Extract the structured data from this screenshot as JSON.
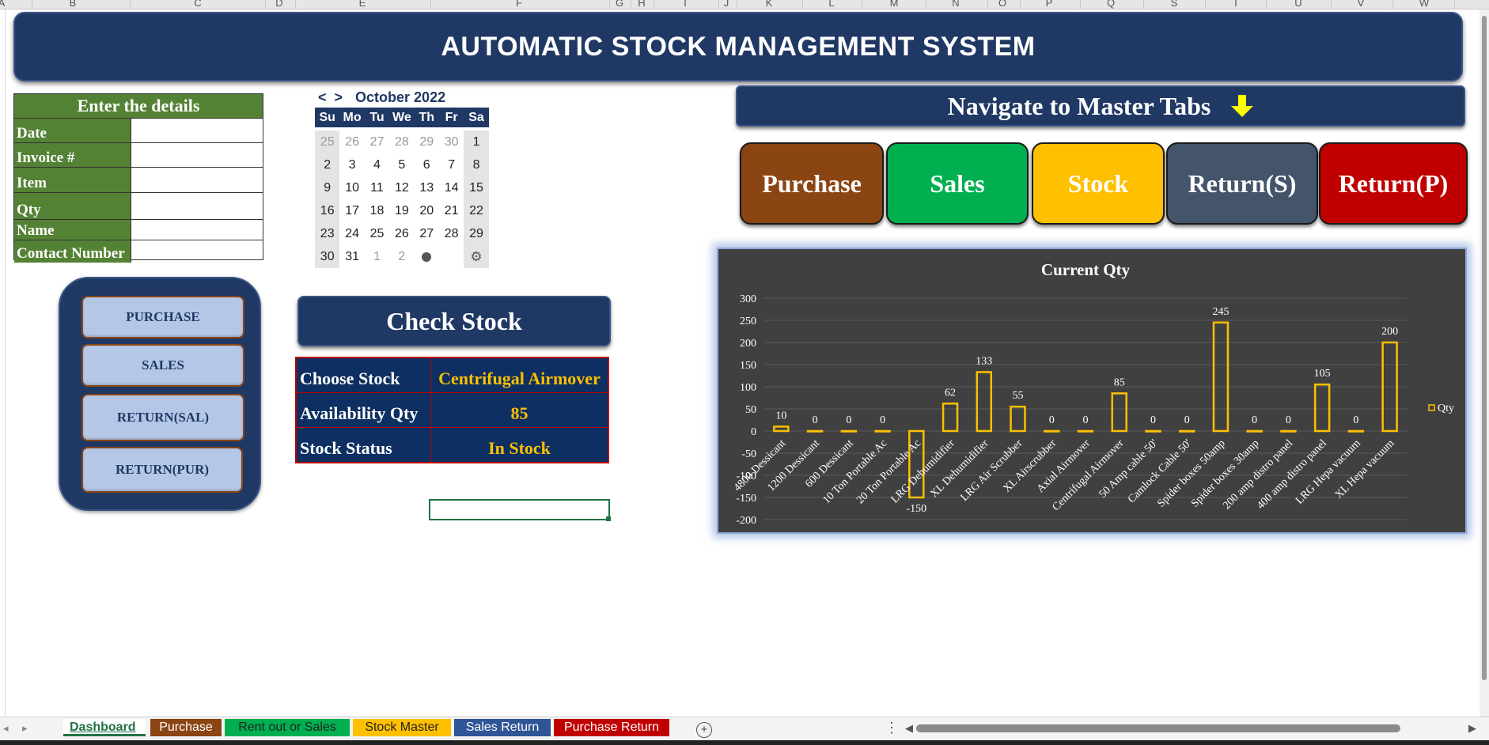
{
  "columns": [
    "A",
    "B",
    "C",
    "D",
    "E",
    "F",
    "G",
    "H",
    "I",
    "J",
    "K",
    "L",
    "M",
    "N",
    "O",
    "P",
    "Q",
    "S",
    "T",
    "U",
    "V",
    "W"
  ],
  "banner": {
    "title": "AUTOMATIC STOCK MANAGEMENT SYSTEM"
  },
  "details": {
    "header": "Enter the details",
    "fields": [
      {
        "label": "Date",
        "value": ""
      },
      {
        "label": "Invoice #",
        "value": ""
      },
      {
        "label": "Item",
        "value": ""
      },
      {
        "label": "Qty",
        "value": ""
      },
      {
        "label": "Name",
        "value": ""
      },
      {
        "label": "Contact Number",
        "value": ""
      }
    ]
  },
  "calendar": {
    "prev": "<",
    "next": ">",
    "month": "October 2022",
    "weekdays": [
      "Su",
      "Mo",
      "Tu",
      "We",
      "Th",
      "Fr",
      "Sa"
    ],
    "weeks": [
      [
        "25",
        "26",
        "27",
        "28",
        "29",
        "30",
        "1"
      ],
      [
        "2",
        "3",
        "4",
        "5",
        "6",
        "7",
        "8"
      ],
      [
        "9",
        "10",
        "11",
        "12",
        "13",
        "14",
        "15"
      ],
      [
        "16",
        "17",
        "18",
        "19",
        "20",
        "21",
        "22"
      ],
      [
        "23",
        "24",
        "25",
        "26",
        "27",
        "28",
        "29"
      ],
      [
        "30",
        "31",
        "1",
        "2",
        "",
        "",
        " "
      ]
    ]
  },
  "left_nav": {
    "buttons": [
      "PURCHASE",
      "SALES",
      "RETURN(SAL)",
      "RETURN(PUR)"
    ]
  },
  "check_stock": {
    "title": "Check Stock",
    "rows": [
      {
        "label": "Choose Stock",
        "value": "Centrifugal Airmover"
      },
      {
        "label": "Availability Qty",
        "value": "85"
      },
      {
        "label": "Stock Status",
        "value": "In Stock"
      }
    ]
  },
  "navigate": {
    "title": "Navigate to Master Tabs",
    "icon": "down-arrow-icon"
  },
  "master_buttons": [
    {
      "label": "Purchase",
      "color": "#8b4513"
    },
    {
      "label": "Sales",
      "color": "#00b050"
    },
    {
      "label": "Stock",
      "color": "#ffc000"
    },
    {
      "label": "Return(S)",
      "color": "#44546a"
    },
    {
      "label": "Return(P)",
      "color": "#c00000"
    }
  ],
  "chart_data": {
    "type": "bar",
    "title": "Current Qty",
    "categories": [
      "4800 Dessicant",
      "1200 Dessicant",
      "600 Dessicant",
      "10 Ton Portable Ac",
      "20 Ton Portable Ac",
      "LRG Dehumidifier",
      "XL Dehumidifier",
      "LRG Air Scrubber",
      "XL Airscrubber",
      "Axial Airmover",
      "Centrifugal Airmover",
      "50 Amp cable 50'",
      "Camlock Cable 50'",
      "Spider boxes 50amp",
      "Spider boxes 30amp",
      "200 amp distro panel",
      "400 amp distro panel",
      "LRG Hepa vacuum",
      "XL Hepa vacuum"
    ],
    "series": [
      {
        "name": "Qty",
        "values": [
          10,
          0,
          0,
          0,
          -150,
          62,
          133,
          55,
          0,
          0,
          85,
          0,
          0,
          245,
          0,
          0,
          105,
          0,
          200
        ]
      }
    ],
    "ylim": [
      -200,
      300
    ],
    "yticks": [
      "300",
      "250",
      "200",
      "150",
      "100",
      "50",
      "0",
      "-50",
      "-100",
      "-150",
      "-200"
    ],
    "bar_color": "#ffc000",
    "background": "#404040",
    "legend": "right",
    "grid": true
  },
  "sheet_tabs": [
    {
      "label": "Dashboard",
      "color": "#ffffff"
    },
    {
      "label": "Purchase",
      "color": "#8b4513"
    },
    {
      "label": "Rent out or Sales",
      "color": "#00b050"
    },
    {
      "label": "Stock Master",
      "color": "#ffc000"
    },
    {
      "label": "Sales Return",
      "color": "#2f5597"
    },
    {
      "label": "Purchase Return",
      "color": "#c00000"
    }
  ],
  "sheet_controls": {
    "add_icon": "plus-icon",
    "more_icon": "more-options-icon"
  }
}
